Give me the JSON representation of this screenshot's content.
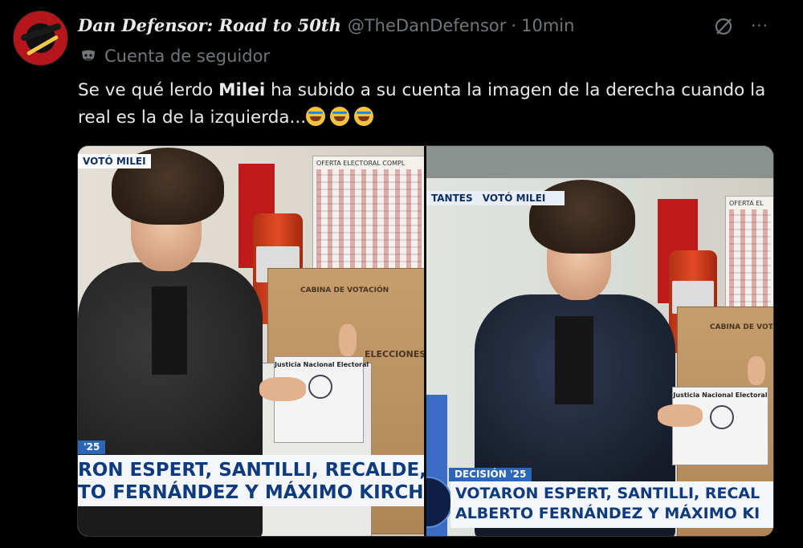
{
  "tweet": {
    "display_name": "Dan Defensor: Road to 50th",
    "handle": "@TheDanDefensor",
    "separator": "·",
    "time": "10min",
    "follower_label": "Cuenta de seguidor",
    "text_before": "Se ve qué lerdo ",
    "text_bold": "Milei",
    "text_after": " ha subido a su cuenta la imagen de la derecha cuando la real es la de la izquierda...",
    "more_label": "···"
  },
  "icons": {
    "avatar": "avatar",
    "grok": "grok-icon",
    "more": "more-icon",
    "follower": "mask-icon",
    "emoji": "rolling-on-floor-laughing-emoji"
  },
  "media": {
    "left": {
      "top_tag": "VOTÓ MILEI",
      "poster_header": "OFERTA ELECTORAL COMPL",
      "box_label_1": "CABINA DE VOTACIÓN",
      "box_label_2": "ELECCIONES",
      "ballot_title": "Justicia Nacional Electoral",
      "lower_tag": "'25",
      "chyron_line1": "RON ESPERT, SANTILLI, RECALDE, RA",
      "chyron_line2": "TO FERNÁNDEZ Y MÁXIMO KIRCHN"
    },
    "right": {
      "top_tag_left": "TANTES",
      "top_tag": "VOTÓ MILEI",
      "poster_header": "OFERTA EL",
      "box_label_1": "CABINA DE VOTACI",
      "ballot_title": "Justicia Nacional Electoral",
      "lower_tag": "DECISIÓN '25",
      "chyron_line1": "VOTARON ESPERT, SANTILLI, RECAL",
      "chyron_line2": "ALBERTO FERNÁNDEZ Y MÁXIMO KI"
    }
  },
  "colors": {
    "background": "#000000",
    "text_primary": "#e7e9ea",
    "text_secondary": "#71767b",
    "chyron_blue": "#0e3a7e",
    "tag_blue": "#2c66b8"
  }
}
